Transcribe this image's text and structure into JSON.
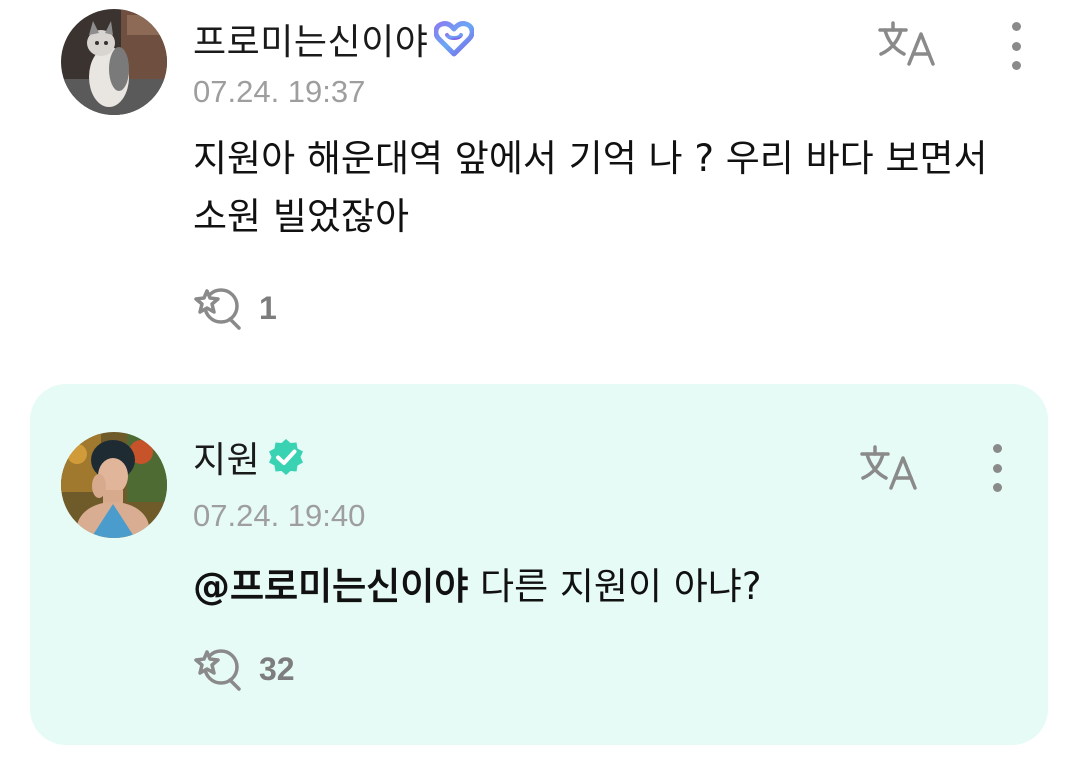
{
  "comments": [
    {
      "author": "프로미는신이야",
      "timestamp": "07.24. 19:37",
      "text": "지원아 해운대역 앞에서 기억 나 ? 우리 바다 보면서 소원 빌었잖아",
      "like_count": "1",
      "badge_icon": "fan-heart-badge-icon",
      "avatar": "cat-avatar"
    },
    {
      "author": "지원",
      "timestamp": "07.24. 19:40",
      "mention": "@프로미는신이야",
      "text": " 다른 지원이 아냐?",
      "like_count": "32",
      "badge_icon": "verified-check-badge-icon",
      "avatar": "artist-avatar"
    }
  ],
  "colors": {
    "artist_bg": "#e6fbf5",
    "verified": "#39d3b4",
    "timestamp": "#9e9e9e",
    "icon_gray": "#8a8a8a"
  }
}
